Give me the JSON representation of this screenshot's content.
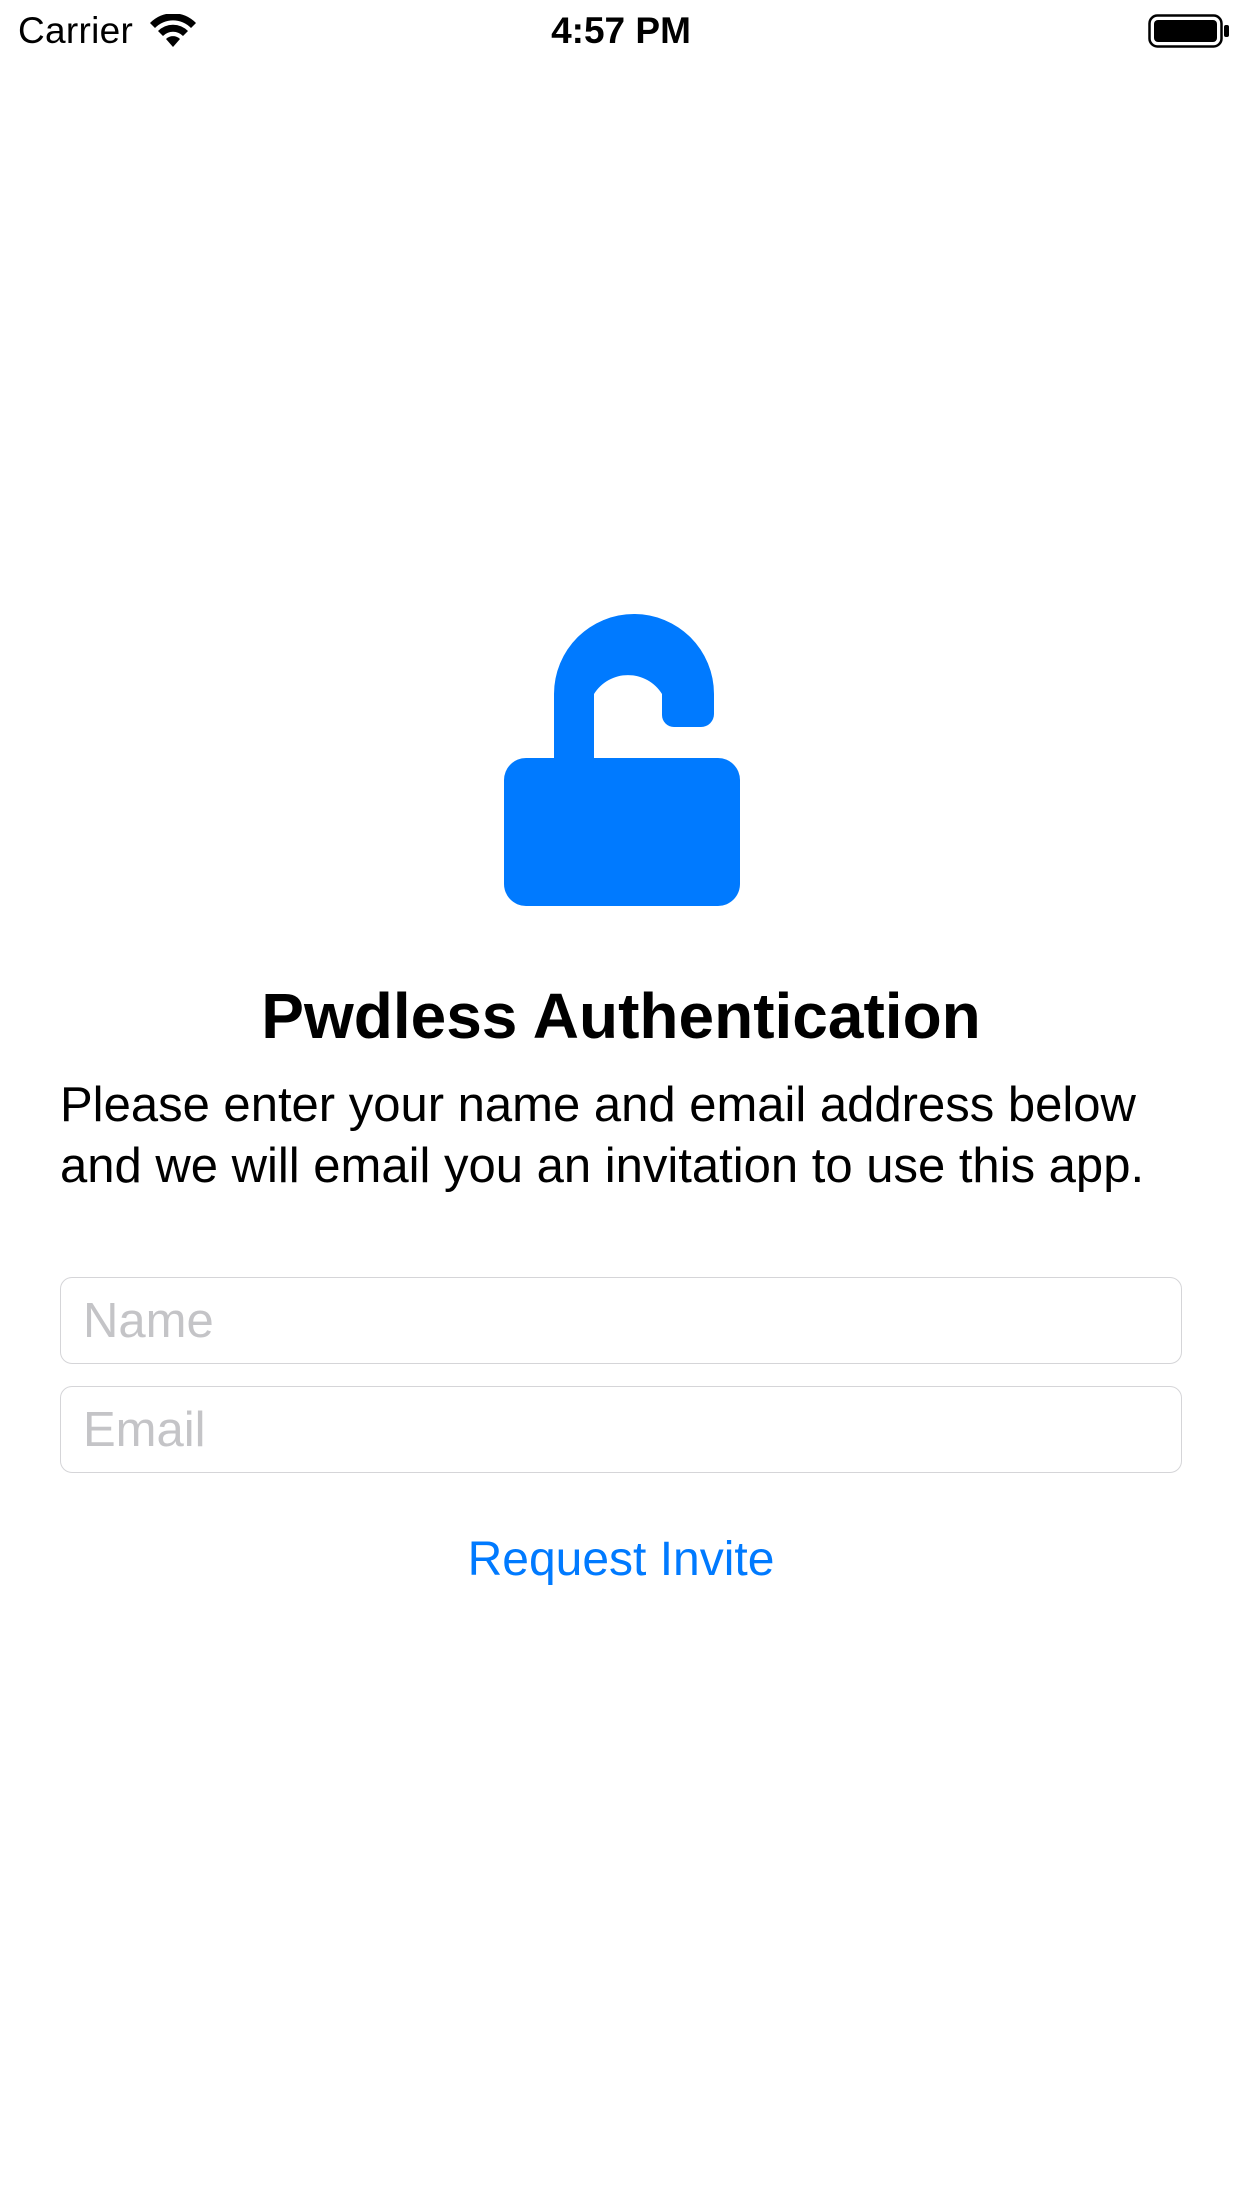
{
  "status_bar": {
    "carrier": "Carrier",
    "time": "4:57 PM",
    "wifi_icon": "wifi-icon",
    "battery_icon": "battery-full-icon"
  },
  "main": {
    "icon": "unlocked-padlock-icon",
    "accent_color": "#007aff",
    "title": "Pwdless Authentication",
    "description": "Please enter your name and email address below and we will email you an invitation to use this app.",
    "name_field": {
      "value": "",
      "placeholder": "Name"
    },
    "email_field": {
      "value": "",
      "placeholder": "Email"
    },
    "request_button_label": "Request Invite"
  }
}
